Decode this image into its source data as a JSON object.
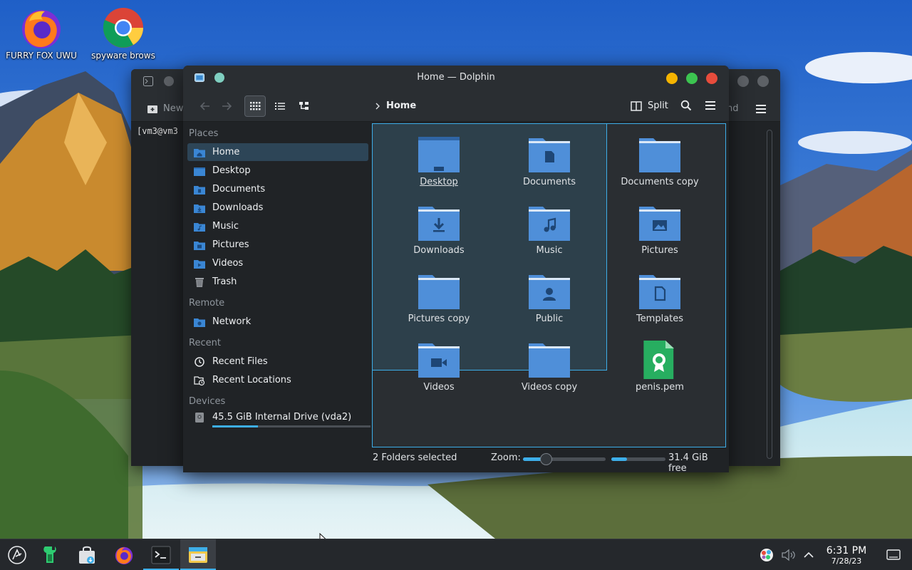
{
  "desktop": {
    "icons": [
      {
        "label": "FURRY FOX UWU"
      },
      {
        "label": "spyware brows"
      }
    ]
  },
  "terminal": {
    "toolbar_new": "New",
    "toolbar_right": "nd",
    "prompt": "[vm3@vm3"
  },
  "dolphin": {
    "title": "Home — Dolphin",
    "breadcrumb": "Home",
    "split_label": "Split",
    "places": {
      "places_header": "Places",
      "items": [
        {
          "label": "Home"
        },
        {
          "label": "Desktop"
        },
        {
          "label": "Documents"
        },
        {
          "label": "Downloads"
        },
        {
          "label": "Music"
        },
        {
          "label": "Pictures"
        },
        {
          "label": "Videos"
        },
        {
          "label": "Trash"
        }
      ],
      "remote_header": "Remote",
      "remote_items": [
        {
          "label": "Network"
        }
      ],
      "recent_header": "Recent",
      "recent_items": [
        {
          "label": "Recent Files"
        },
        {
          "label": "Recent Locations"
        }
      ],
      "devices_header": "Devices",
      "device_items": [
        {
          "label": "45.5 GiB Internal Drive (vda2)",
          "used_fraction": 0.29
        }
      ]
    },
    "files": [
      {
        "name": "Desktop",
        "icon": "folder-desktop"
      },
      {
        "name": "Documents",
        "icon": "folder-documents"
      },
      {
        "name": "Documents copy",
        "icon": "folder"
      },
      {
        "name": "Downloads",
        "icon": "folder-downloads"
      },
      {
        "name": "Music",
        "icon": "folder-music"
      },
      {
        "name": "Pictures",
        "icon": "folder-pictures"
      },
      {
        "name": "Pictures copy",
        "icon": "folder"
      },
      {
        "name": "Public",
        "icon": "folder-public"
      },
      {
        "name": "Templates",
        "icon": "folder-templates"
      },
      {
        "name": "Videos",
        "icon": "folder-videos"
      },
      {
        "name": "Videos copy",
        "icon": "folder"
      },
      {
        "name": "penis.pem",
        "icon": "certificate-file"
      }
    ],
    "status": {
      "selection": "2 Folders selected",
      "zoom_label": "Zoom:",
      "zoom_fraction": 0.28,
      "disk_used_fraction": 0.29,
      "free": "31.4 GiB free"
    }
  },
  "taskbar": {
    "time": "6:31 PM",
    "date": "7/28/23"
  },
  "colors": {
    "accent": "#3daee9",
    "folder": "#4f8fd9",
    "close": "#e74c3c",
    "minimize": "#f5b400",
    "maximize": "#3cc450"
  }
}
